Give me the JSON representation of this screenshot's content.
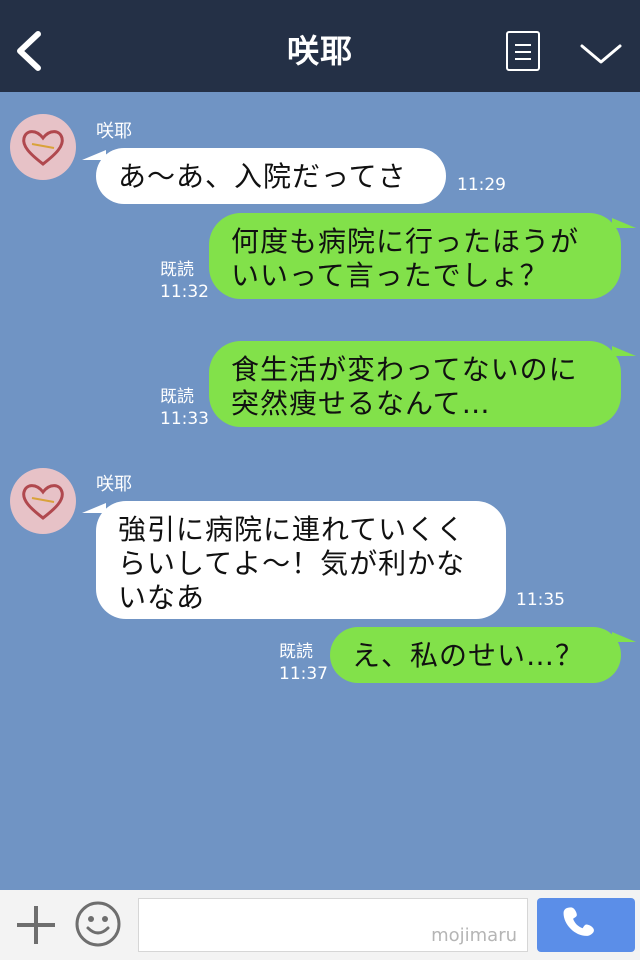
{
  "header": {
    "title": "咲耶",
    "back_icon": "chevron-left-icon",
    "menu_icon": "menu-icon",
    "collapse_icon": "chevron-down-icon"
  },
  "colors": {
    "header_bg": "#243046",
    "chat_bg": "#7094c4",
    "outgoing_bubble": "#82e14a",
    "incoming_bubble": "#ffffff",
    "call_button": "#5b8ee8"
  },
  "messages": [
    {
      "direction": "in",
      "sender": "咲耶",
      "lines": [
        "あ〜あ、入院だってさ"
      ],
      "time": "11:29"
    },
    {
      "direction": "out",
      "lines": [
        "何度も病院に行ったほうが",
        "いいって言ったでしょ？"
      ],
      "read": "既読",
      "time": "11:32"
    },
    {
      "direction": "out",
      "lines": [
        "食生活が変わってないのに",
        "突然痩せるなんて…"
      ],
      "read": "既読",
      "time": "11:33"
    },
    {
      "direction": "in",
      "sender": "咲耶",
      "lines": [
        "強引に病院に連れていくく",
        "らいしてよ〜！気が利かな",
        "いなあ"
      ],
      "time": "11:35"
    },
    {
      "direction": "out",
      "lines": [
        "え、私のせい…？"
      ],
      "read": "既読",
      "time": "11:37"
    }
  ],
  "footer": {
    "plus_icon": "plus-icon",
    "emoji_icon": "smiley-icon",
    "input_value": "",
    "watermark": "mojimaru",
    "call_icon": "phone-icon"
  }
}
